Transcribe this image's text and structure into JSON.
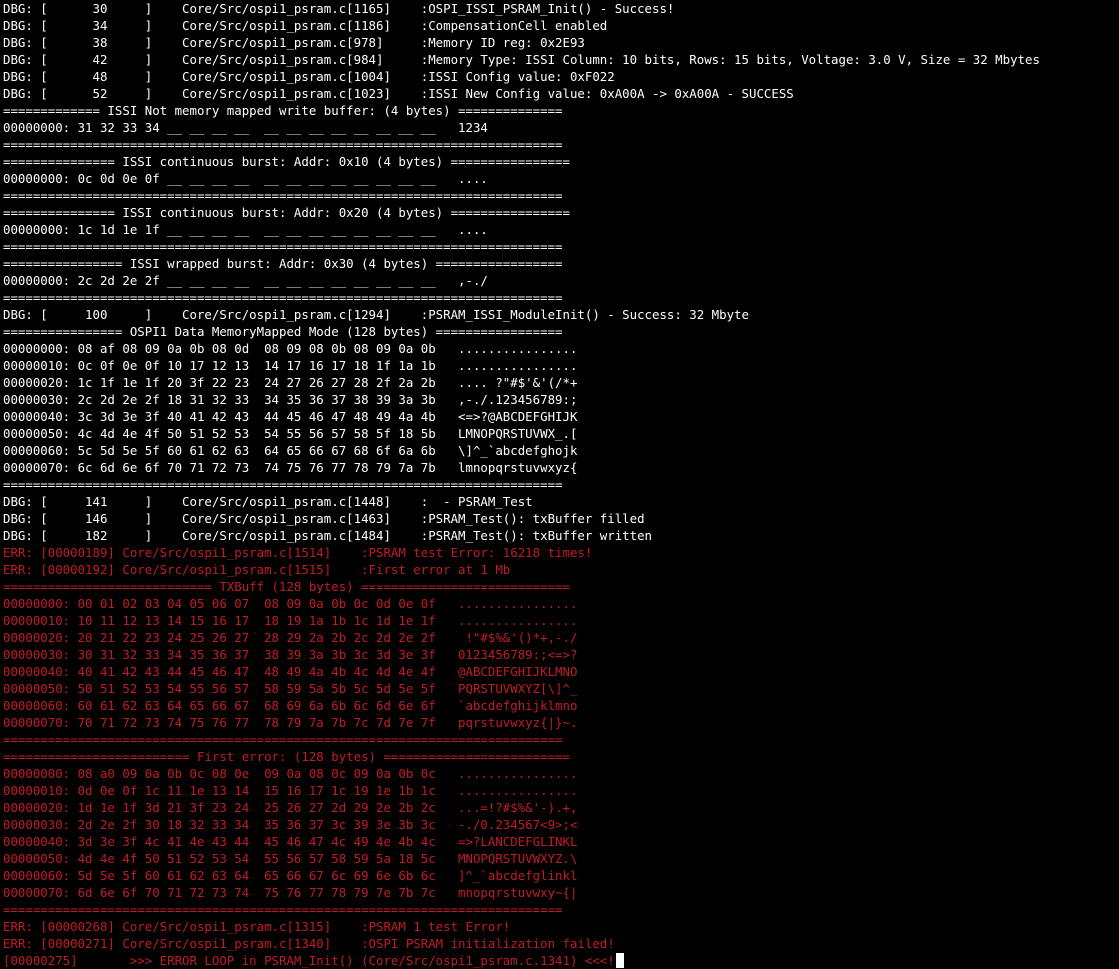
{
  "terminal": {
    "colors": {
      "background": "#000000",
      "normal_text": "#ffffff",
      "error_text": "#c01c28",
      "cursor": "#ffffff"
    },
    "lines": [
      {
        "text": "DBG: [      30     ]    Core/Src/ospi1_psram.c[1165]    :OSPI_ISSI_PSRAM_Init() - Success!",
        "color": "white"
      },
      {
        "text": "DBG: [      34     ]    Core/Src/ospi1_psram.c[1186]    :CompensationCell enabled",
        "color": "white"
      },
      {
        "text": "DBG: [      38     ]    Core/Src/ospi1_psram.c[978]     :Memory ID reg: 0x2E93",
        "color": "white"
      },
      {
        "text": "DBG: [      42     ]    Core/Src/ospi1_psram.c[984]     :Memory Type: ISSI Column: 10 bits, Rows: 15 bits, Voltage: 3.0 V, Size = 32 Mbytes",
        "color": "white"
      },
      {
        "text": "DBG: [      48     ]    Core/Src/ospi1_psram.c[1004]    :ISSI Config value: 0xF022",
        "color": "white"
      },
      {
        "text": "DBG: [      52     ]    Core/Src/ospi1_psram.c[1023]    :ISSI New Config value: 0xA00A -> 0xA00A - SUCCESS",
        "color": "white"
      },
      {
        "text": "============= ISSI Not memory mapped write buffer: (4 bytes) ==============",
        "color": "white"
      },
      {
        "text": "00000000: 31 32 33 34 __ __ __ __  __ __ __ __ __ __ __ __   1234",
        "color": "white"
      },
      {
        "text": "===========================================================================",
        "color": "white"
      },
      {
        "text": "=============== ISSI continuous burst: Addr: 0x10 (4 bytes) ================",
        "color": "white"
      },
      {
        "text": "00000000: 0c 0d 0e 0f __ __ __ __  __ __ __ __ __ __ __ __   ....",
        "color": "white"
      },
      {
        "text": "===========================================================================",
        "color": "white"
      },
      {
        "text": "=============== ISSI continuous burst: Addr: 0x20 (4 bytes) ================",
        "color": "white"
      },
      {
        "text": "00000000: 1c 1d 1e 1f __ __ __ __  __ __ __ __ __ __ __ __   ....",
        "color": "white"
      },
      {
        "text": "===========================================================================",
        "color": "white"
      },
      {
        "text": "================ ISSI wrapped burst: Addr: 0x30 (4 bytes) =================",
        "color": "white"
      },
      {
        "text": "00000000: 2c 2d 2e 2f __ __ __ __  __ __ __ __ __ __ __ __   ,-./",
        "color": "white"
      },
      {
        "text": "===========================================================================",
        "color": "white"
      },
      {
        "text": "DBG: [     100     ]    Core/Src/ospi1_psram.c[1294]    :PSRAM_ISSI_ModuleInit() - Success: 32 Mbyte",
        "color": "white"
      },
      {
        "text": "================ OSPI1 Data MemoryMapped Mode (128 bytes) =================",
        "color": "white"
      },
      {
        "text": "00000000: 08 af 08 09 0a 0b 08 0d  08 09 08 0b 08 09 0a 0b   ................",
        "color": "white"
      },
      {
        "text": "00000010: 0c 0f 0e 0f 10 17 12 13  14 17 16 17 18 1f 1a 1b   ................",
        "color": "white"
      },
      {
        "text": "00000020: 1c 1f 1e 1f 20 3f 22 23  24 27 26 27 28 2f 2a 2b   .... ?\"#$'&'(/*+",
        "color": "white"
      },
      {
        "text": "00000030: 2c 2d 2e 2f 18 31 32 33  34 35 36 37 38 39 3a 3b   ,-./.123456789:;",
        "color": "white"
      },
      {
        "text": "00000040: 3c 3d 3e 3f 40 41 42 43  44 45 46 47 48 49 4a 4b   <=>?@ABCDEFGHIJK",
        "color": "white"
      },
      {
        "text": "00000050: 4c 4d 4e 4f 50 51 52 53  54 55 56 57 58 5f 18 5b   LMNOPQRSTUVWX_.[",
        "color": "white"
      },
      {
        "text": "00000060: 5c 5d 5e 5f 60 61 62 63  64 65 66 67 68 6f 6a 6b   \\]^_`abcdefghojk",
        "color": "white"
      },
      {
        "text": "00000070: 6c 6d 6e 6f 70 71 72 73  74 75 76 77 78 79 7a 7b   lmnopqrstuvwxyz{",
        "color": "white"
      },
      {
        "text": "===========================================================================",
        "color": "white"
      },
      {
        "text": "DBG: [     141     ]    Core/Src/ospi1_psram.c[1448]    :  - PSRAM_Test",
        "color": "white"
      },
      {
        "text": "DBG: [     146     ]    Core/Src/ospi1_psram.c[1463]    :PSRAM_Test(): txBuffer filled",
        "color": "white"
      },
      {
        "text": "DBG: [     182     ]    Core/Src/ospi1_psram.c[1484]    :PSRAM_Test(): txBuffer written",
        "color": "white"
      },
      {
        "text": "ERR: [00000189] Core/Src/ospi1_psram.c[1514]    :PSRAM test Error: 16218 times!",
        "color": "red"
      },
      {
        "text": "ERR: [00000192] Core/Src/ospi1_psram.c[1515]    :First error at 1 Mb",
        "color": "red"
      },
      {
        "text": "============================ TXBuff (128 bytes) ============================",
        "color": "red"
      },
      {
        "text": "00000000: 00 01 02 03 04 05 06 07  08 09 0a 0b 0c 0d 0e 0f   ................",
        "color": "red"
      },
      {
        "text": "00000010: 10 11 12 13 14 15 16 17  18 19 1a 1b 1c 1d 1e 1f   ................",
        "color": "red"
      },
      {
        "text": "00000020: 20 21 22 23 24 25 26 27  28 29 2a 2b 2c 2d 2e 2f    !\"#$%&'()*+,-./",
        "color": "red"
      },
      {
        "text": "00000030: 30 31 32 33 34 35 36 37  38 39 3a 3b 3c 3d 3e 3f   0123456789:;<=>?",
        "color": "red"
      },
      {
        "text": "00000040: 40 41 42 43 44 45 46 47  48 49 4a 4b 4c 4d 4e 4f   @ABCDEFGHIJKLMNO",
        "color": "red"
      },
      {
        "text": "00000050: 50 51 52 53 54 55 56 57  58 59 5a 5b 5c 5d 5e 5f   PQRSTUVWXYZ[\\]^_",
        "color": "red"
      },
      {
        "text": "00000060: 60 61 62 63 64 65 66 67  68 69 6a 6b 6c 6d 6e 6f   `abcdefghijklmno",
        "color": "red"
      },
      {
        "text": "00000070: 70 71 72 73 74 75 76 77  78 79 7a 7b 7c 7d 7e 7f   pqrstuvwxyz{|}~.",
        "color": "red"
      },
      {
        "text": "===========================================================================",
        "color": "red"
      },
      {
        "text": "========================= First error: (128 bytes) =========================",
        "color": "red"
      },
      {
        "text": "00000000: 08 a0 09 0a 0b 0c 08 0e  09 0a 08 0c 09 0a 0b 0c   ................",
        "color": "red"
      },
      {
        "text": "00000010: 0d 0e 0f 1c 11 1e 13 14  15 16 17 1c 19 1e 1b 1c   ................",
        "color": "red"
      },
      {
        "text": "00000020: 1d 1e 1f 3d 21 3f 23 24  25 26 27 2d 29 2e 2b 2c   ...=!?#$%&'-).+,",
        "color": "red"
      },
      {
        "text": "00000030: 2d 2e 2f 30 18 32 33 34  35 36 37 3c 39 3e 3b 3c   -./0.234567<9>;<",
        "color": "red"
      },
      {
        "text": "00000040: 3d 3e 3f 4c 41 4e 43 44  45 46 47 4c 49 4e 4b 4c   =>?LANCDEFGLINKL",
        "color": "red"
      },
      {
        "text": "00000050: 4d 4e 4f 50 51 52 53 54  55 56 57 58 59 5a 18 5c   MNOPQRSTUVWXYZ.\\",
        "color": "red"
      },
      {
        "text": "00000060: 5d 5e 5f 60 61 62 63 64  65 66 67 6c 69 6e 6b 6c   ]^_`abcdefglinkl",
        "color": "red"
      },
      {
        "text": "00000070: 6d 6e 6f 70 71 72 73 74  75 76 77 78 79 7e 7b 7c   mnopqrstuvwxy~{|",
        "color": "red"
      },
      {
        "text": "===========================================================================",
        "color": "red"
      },
      {
        "text": "ERR: [00000268] Core/Src/ospi1_psram.c[1315]    :PSRAM 1 test Error!",
        "color": "red"
      },
      {
        "text": "ERR: [00000271] Core/Src/ospi1_psram.c[1340]    :OSPI PSRAM initialization failed!",
        "color": "red"
      },
      {
        "text": "[00000275]       >>> ERROR LOOP in PSRAM_Init() (Core/Src/ospi1_psram.c.1341) <<<!",
        "color": "red",
        "cursor": true
      }
    ]
  }
}
